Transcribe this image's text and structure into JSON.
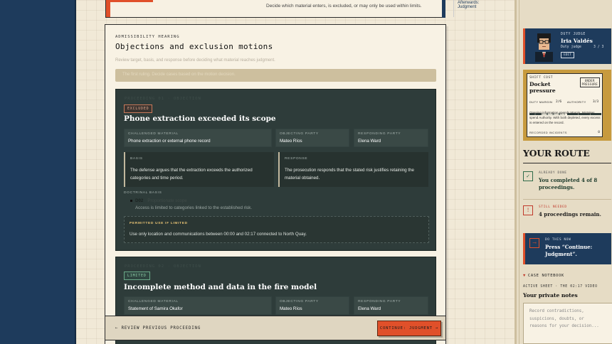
{
  "top_card": {
    "caption": "Decide which material enters, is excluded, or may only be used within limits.",
    "right_text": "Afterwards: Judgment"
  },
  "hearing": {
    "kicker": "ADMISSIBILITY HEARING",
    "title": "Objections and exclusion motions",
    "subtitle": "Review target, basis, and response before deciding what material reaches judgment.",
    "banner": "The first ruling. Decide cases based on the motion decision."
  },
  "proceedings": [
    {
      "kicker": "PROCEEDING 01 · OBJECTION",
      "status": "EXCLUDED",
      "title": "Phone extraction exceeded its scope",
      "challenged_label": "CHALLENGED MATERIAL",
      "challenged": "Phone extraction or external phone record",
      "objecting_label": "OBJECTING PARTY",
      "objecting": "Mateo Ríos",
      "responding_label": "RESPONDING PARTY",
      "responding": "Elena Ward",
      "basis_label": "BASIS",
      "basis": "The defense argues that the extraction exceeds the authorized categories and time period.",
      "response_label": "RESPONSE",
      "response": "The prosecution responds that the stated risk justifies retaining the material obtained.",
      "doctrinal_label": "DOCTRINAL BASIS",
      "doctrinal_code": "D02",
      "doctrinal_name": "Proportionate scope",
      "doctrinal_desc": "Access is limited to categories linked to the established risk.",
      "permitted_label": "PERMITTED USE IF LIMITED",
      "permitted": "Use only location and communications between 00:00 and 02:17 connected to North Quay."
    },
    {
      "kicker": "PROCEEDING 02 · OBJECTION",
      "status": "LIMITED",
      "title": "Incomplete method and data in the fire model",
      "challenged_label": "CHALLENGED MATERIAL",
      "challenged": "Statement of Samira Okafor",
      "objecting_label": "OBJECTING PARTY",
      "objecting": "Mateo Ríos",
      "responding_label": "RESPONDING PARTY",
      "responding": "Elena Ward"
    }
  ],
  "navbar": {
    "back": "← REVIEW PREVIOUS PROCEEDING",
    "continue": "CONTINUE: JUDGMENT →"
  },
  "judge": {
    "label": "DUTY JUDGE",
    "name": "Iria Valdés",
    "role": "Duty judge",
    "count": "3 / 3",
    "edit": "EDIT"
  },
  "shift": {
    "label": "SHIFT COST",
    "title_1": "Docket",
    "title_2": "pressure",
    "under_1": "UNDER",
    "under_2": "PRESSURE",
    "margin_label": "DUTY MARGIN",
    "margin_value": "2/6",
    "margin_fraction": 0.33,
    "authority_label": "AUTHORITY",
    "authority_value": "3/3",
    "authority_fraction": 1.0,
    "description": "Opening information spends Margin. Mistakes spend Authority. With both depleted, every excess is entered on the record.",
    "recorded_label": "RECORDED INCIDENTS",
    "recorded_value": "0"
  },
  "route": {
    "heading": "YOUR ROUTE",
    "done_label": "ALREADY DONE",
    "done_text": "You completed 4 of 8 proceedings.",
    "needed_label": "STILL NEEDED",
    "needed_text": "4 proceedings remain.",
    "now_label": "DO THIS NOW",
    "now_text": "Press “Continue: Judgment”."
  },
  "notebook": {
    "heading": "CASE NOTEBOOK",
    "sheet": "ACTIVE SHEET · THE 02:17 VIDEO",
    "title": "Your private notes",
    "placeholder": "Record contradictions, suspicions, doubts, or reasons for your decision..."
  },
  "colors": {
    "navy": "#1e3b5c",
    "accent_orange": "#e0502a",
    "dark_card": "#2e3c3a",
    "paper": "#f8f2e4",
    "gold": "#c79a3e",
    "green": "#2f6b49",
    "red": "#c0392b"
  }
}
